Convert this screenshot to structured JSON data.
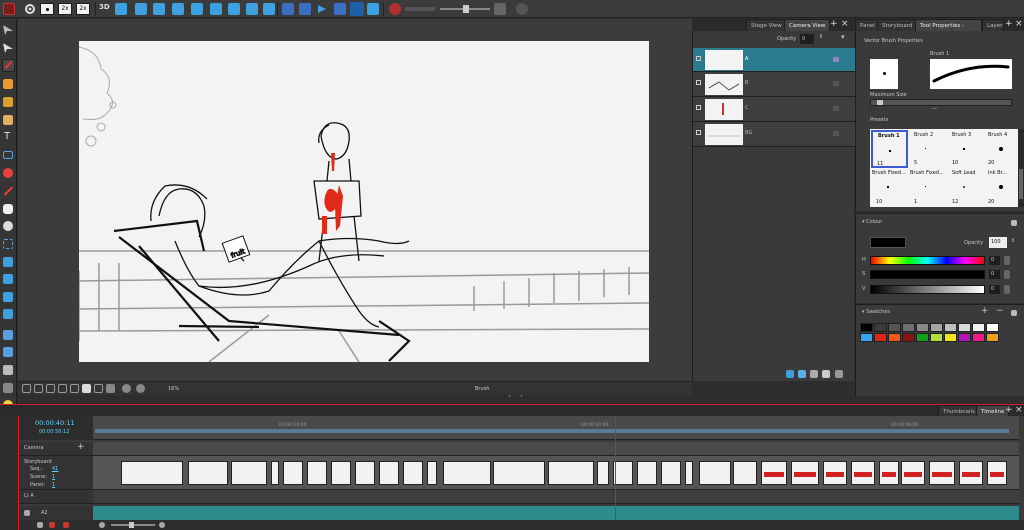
{
  "toolbar": {
    "zoom_2x_a": "2x",
    "zoom_2x_b": "2x",
    "label_3d": "3D"
  },
  "view_tabs": {
    "stage": "Stage View",
    "camera": "Camera View"
  },
  "right_tabs": {
    "panel": "Panel",
    "storyboard": "Storyboard",
    "tool_props": "Tool Properties : Colour",
    "layers": "Layers"
  },
  "layers_panel": {
    "opacity_label": "Opacity",
    "opacity_value": "0",
    "layers": [
      {
        "name": "A",
        "selected": true
      },
      {
        "name": "B",
        "selected": false
      },
      {
        "name": "C",
        "selected": false
      },
      {
        "name": "BG",
        "selected": false
      }
    ]
  },
  "vector_brush": {
    "title": "Vector Brush Properties",
    "brush_label": "Brush 1",
    "max_size_label": "Maximum Size",
    "presets_label": "Presets",
    "presets": [
      {
        "name": "Brush 1",
        "size": "11"
      },
      {
        "name": "Brush 2",
        "size": "5"
      },
      {
        "name": "Brush 3",
        "size": "10"
      },
      {
        "name": "Brush 4",
        "size": "20"
      },
      {
        "name": "Brush Fixed...",
        "size": "10"
      },
      {
        "name": "Brush Fixed...",
        "size": "1"
      },
      {
        "name": "Soft Lead",
        "size": "12"
      },
      {
        "name": "Ink Br...",
        "size": "20"
      }
    ]
  },
  "colour_panel": {
    "title": "Colour",
    "opacity_label": "Opacity",
    "opacity_value": "100",
    "h_label": "H",
    "h_value": "0",
    "s_label": "S",
    "s_value": "0",
    "v_label": "V",
    "v_value": "0"
  },
  "swatches": {
    "title": "Swatches",
    "row1": [
      "#000000",
      "#3a3a3a",
      "#555555",
      "#707070",
      "#8a8a8a",
      "#a5a5a5",
      "#c0c0c0",
      "#dadada",
      "#f0f0f0",
      "#ffffff"
    ],
    "row2": [
      "#37a4f0",
      "#e0241a",
      "#f05a14",
      "#8a1414",
      "#14a014",
      "#aee03a",
      "#f0e614",
      "#b414b4",
      "#f01a8a",
      "#f0a014"
    ]
  },
  "stage_status": {
    "zoom": "16%",
    "tool": "Brush"
  },
  "timeline_tabs": {
    "thumbnails": "Thumbnails",
    "timeline": "Timeline"
  },
  "timeline": {
    "current_time": "00:00:40:11",
    "total_time": "00:00:50:12",
    "ruler": [
      "00:00:10:00",
      "00:00:40:00",
      "00:00:49:00"
    ],
    "camera_label": "Camera",
    "storyboard_label": "Storyboard",
    "seq_label": "Seq.:",
    "seq_value": "41",
    "scene_label": "Scene:",
    "scene_value": "1",
    "panel_label": "Panel:",
    "panel_value": "1",
    "track_a1": "L) A",
    "track_a2": "A2"
  },
  "colors": {
    "accent": "#2b7b8f",
    "selection": "#3c8dbf",
    "playhead": "#d02020",
    "timecode": "#5fd4ff"
  }
}
